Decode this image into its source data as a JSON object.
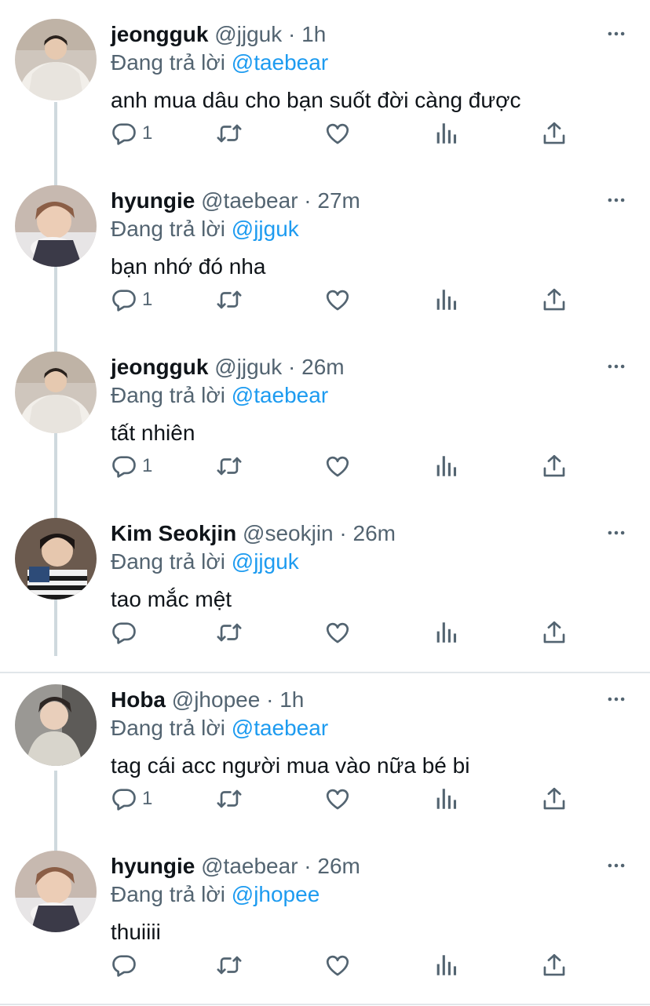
{
  "tweets": [
    {
      "name": "jeongguk",
      "handle": "@jjguk",
      "time": "1h",
      "replying_label": "Đang trả lời",
      "replying_to": "@taebear",
      "text": "anh mua dâu cho bạn suốt đời càng được",
      "reply_count": "1",
      "avatar": "avatar-jeongguk"
    },
    {
      "name": "hyungie",
      "handle": "@taebear",
      "time": "27m",
      "replying_label": "Đang trả lời",
      "replying_to": "@jjguk",
      "text": "bạn nhớ đó nha",
      "reply_count": "1",
      "avatar": "avatar-hyungie"
    },
    {
      "name": "jeongguk",
      "handle": "@jjguk",
      "time": "26m",
      "replying_label": "Đang trả lời",
      "replying_to": "@taebear",
      "text": "tất nhiên",
      "reply_count": "1",
      "avatar": "avatar-jeongguk"
    },
    {
      "name": "Kim Seokjin",
      "handle": "@seokjin",
      "time": "26m",
      "replying_label": "Đang trả lời",
      "replying_to": "@jjguk",
      "text": "tao mắc mệt",
      "reply_count": "",
      "avatar": "avatar-seokjin"
    },
    {
      "name": "Hoba",
      "handle": "@jhopee",
      "time": "1h",
      "replying_label": "Đang trả lời",
      "replying_to": "@taebear",
      "text": "tag cái acc người mua vào nữa bé bi",
      "reply_count": "1",
      "avatar": "avatar-hoba"
    },
    {
      "name": "hyungie",
      "handle": "@taebear",
      "time": "26m",
      "replying_label": "Đang trả lời",
      "replying_to": "@jhopee",
      "text": "thuiiii",
      "reply_count": "",
      "avatar": "avatar-hyungie"
    }
  ],
  "separator": "·",
  "icons": {
    "reply": "reply-icon",
    "retweet": "retweet-icon",
    "like": "heart-icon",
    "analytics": "analytics-icon",
    "share": "share-icon",
    "more": "more-icon"
  },
  "colors": {
    "text": "#0f1419",
    "secondary": "#536471",
    "link": "#1d9bf0",
    "thread": "#cfd9de"
  }
}
